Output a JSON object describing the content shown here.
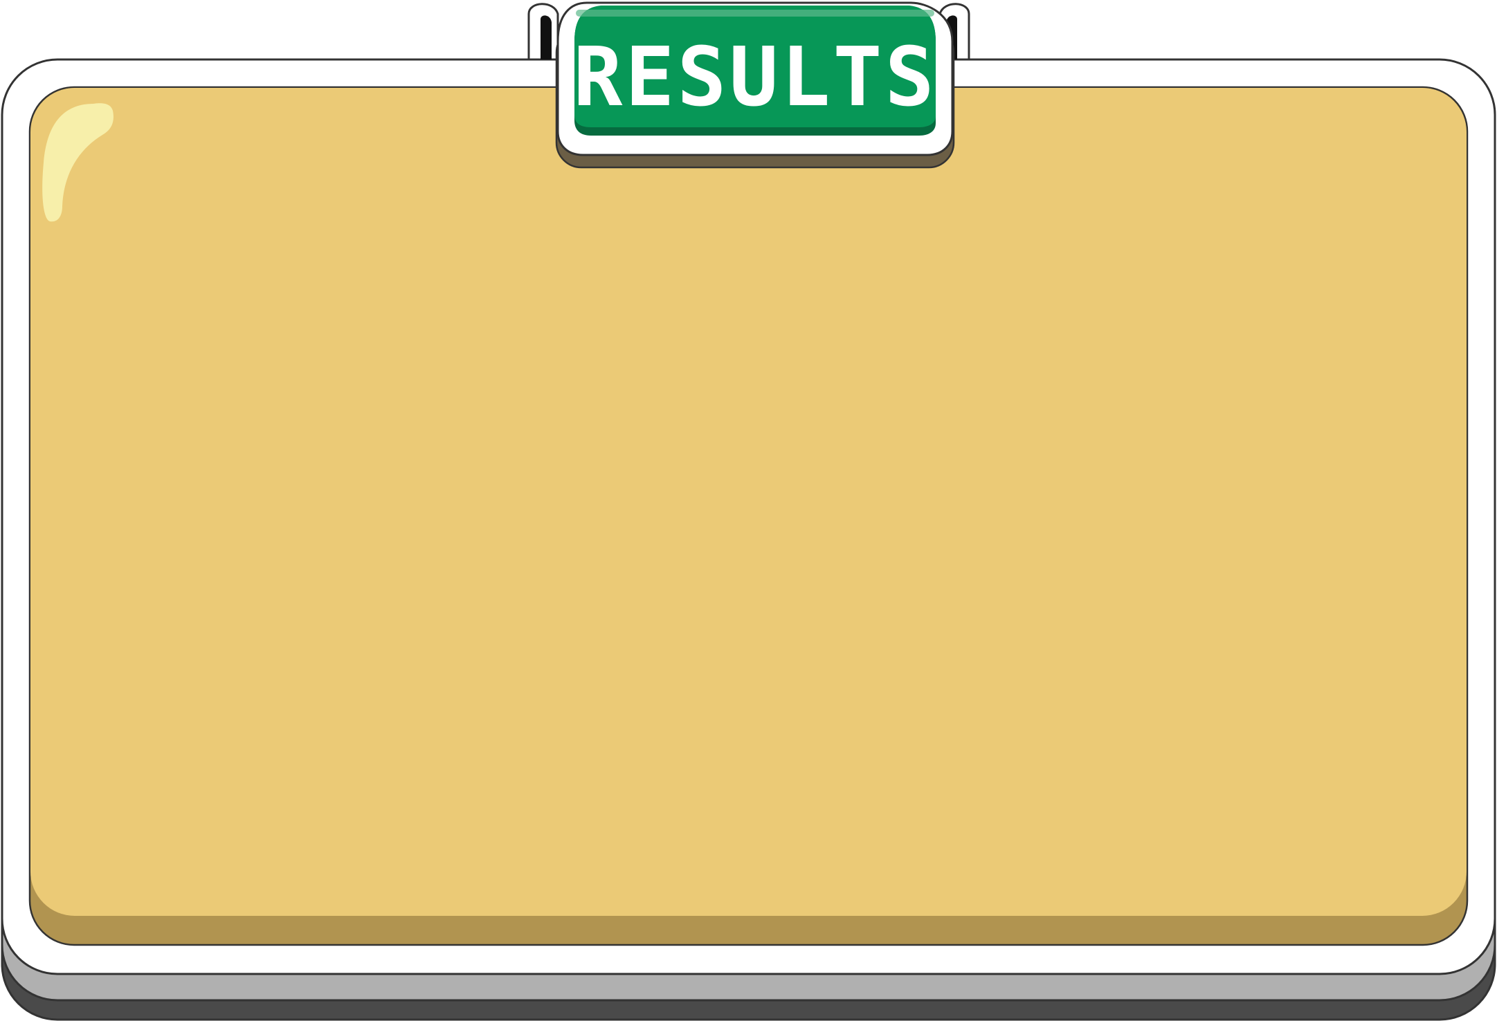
{
  "panel": {
    "title": "RESULTS"
  },
  "colors": {
    "panel_fill": "#EBCA76",
    "panel_shadow": "#B19450",
    "panel_highlight": "#F7EFAA",
    "frame_white": "#FFFFFF",
    "frame_grey": "#B0B0B0",
    "frame_dark": "#4A4A4A",
    "outline": "#333333",
    "banner_green": "#079757",
    "banner_dark_green": "#066B3F",
    "banner_shadow": "#6B5E45",
    "title_text": "#FFFFFF"
  }
}
